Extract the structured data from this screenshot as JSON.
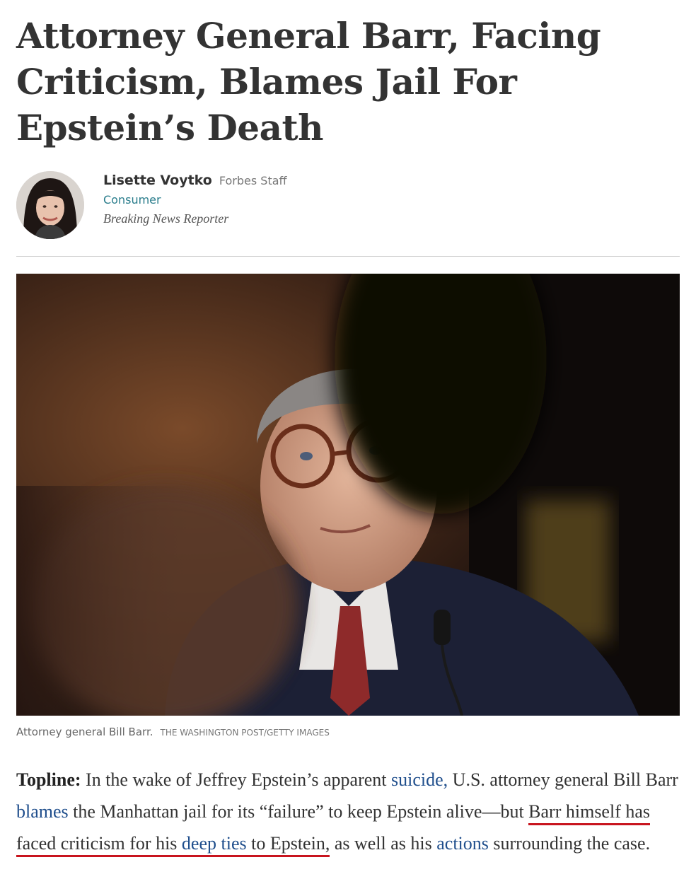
{
  "article": {
    "headline": "Attorney General Barr, Facing Criticism, Blames Jail For Epstein’s Death",
    "author": {
      "name": "Lisette Voytko",
      "role": "Forbes Staff",
      "channel": "Consumer",
      "title": "Breaking News Reporter"
    },
    "image": {
      "caption": "Attorney general Bill Barr.",
      "credit": "THE WASHINGTON POST/GETTY IMAGES"
    },
    "body": {
      "label": "Topline:",
      "t1": " In the wake of Jeffrey Epstein’s apparent ",
      "link_suicide": "suicide,",
      "t2": " U.S. attorney general Bill Barr ",
      "link_blames": "blames",
      "t3": " the Manhattan jail for its “failure” to keep Epstein alive—but ",
      "marked_start": "Barr himself has faced criticism for his ",
      "link_deep_ties": "deep ties",
      "marked_end": " to Epstein,",
      "t4": " as well as his ",
      "link_actions": "actions",
      "t5": " surrounding the case."
    }
  },
  "colors": {
    "link": "#1f4e8c",
    "channel": "#2a7d8c",
    "annotation_underline": "#c8141e"
  }
}
